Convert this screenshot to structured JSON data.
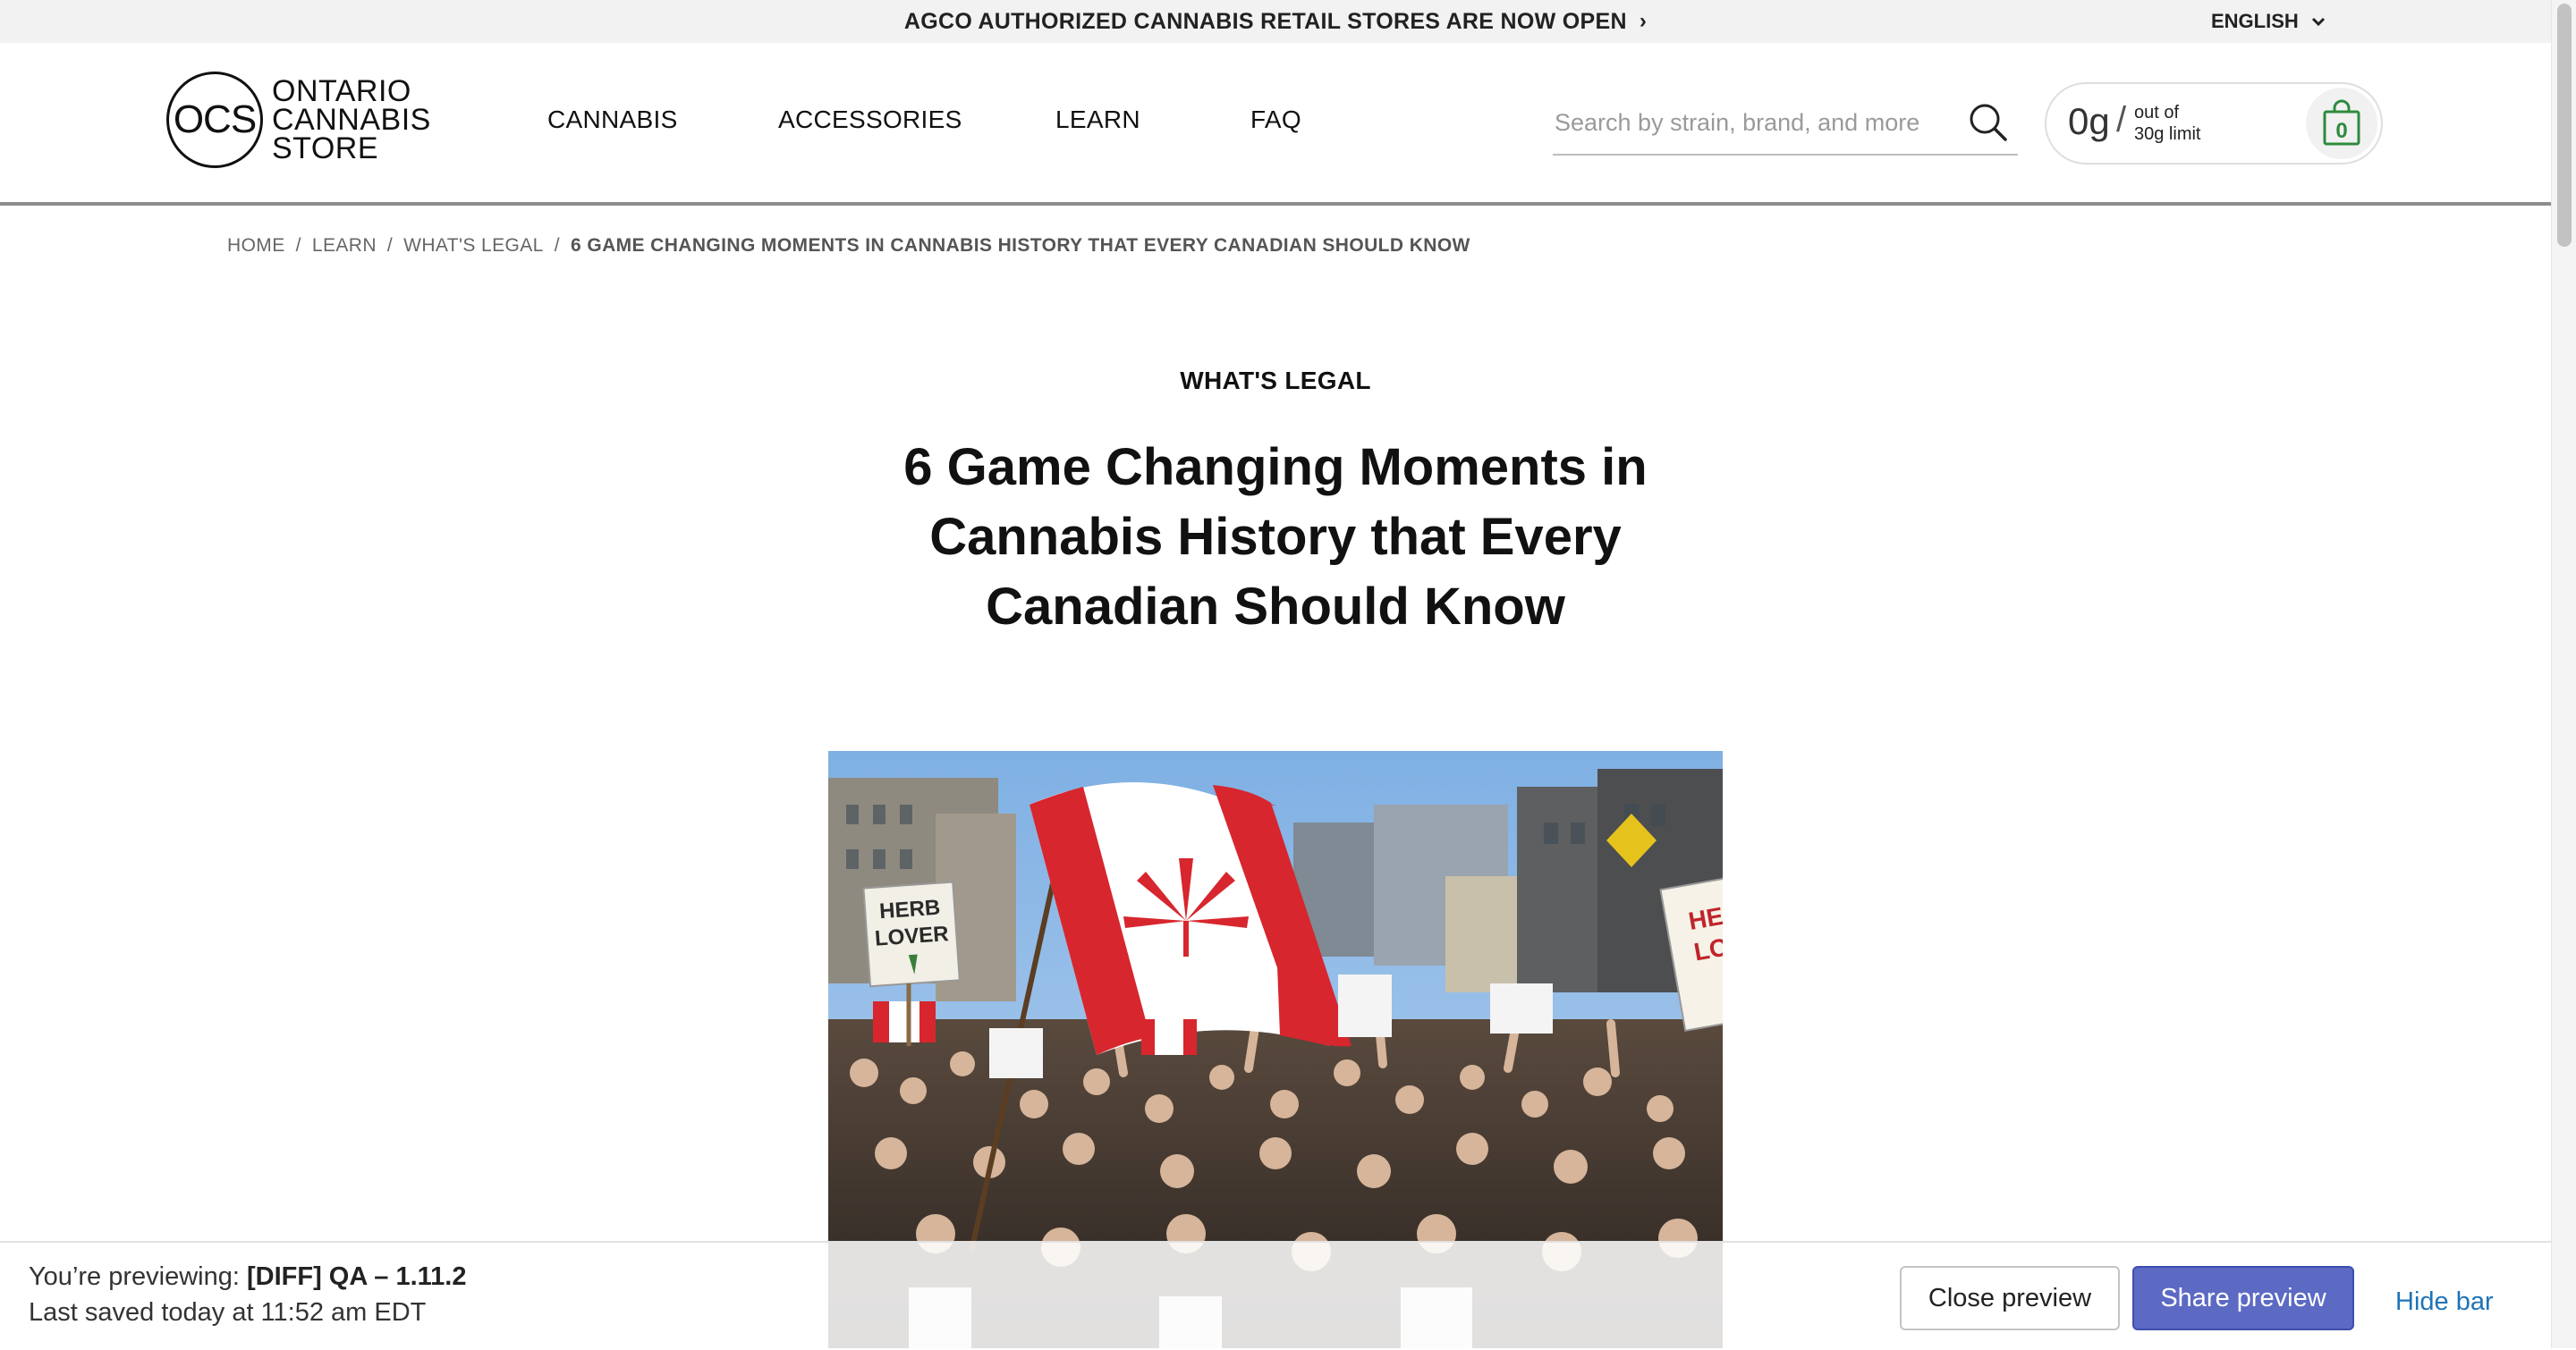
{
  "announcement": {
    "text": "AGCO AUTHORIZED CANNABIS RETAIL STORES ARE NOW OPEN",
    "chevron": "›"
  },
  "language": {
    "label": "ENGLISH"
  },
  "logo": {
    "monogram": "OCS",
    "line1": "ONTARIO",
    "line2": "CANNABIS",
    "line3": "STORE"
  },
  "nav": {
    "items": [
      {
        "label": "CANNABIS"
      },
      {
        "label": "ACCESSORIES"
      },
      {
        "label": "LEARN"
      },
      {
        "label": "FAQ"
      }
    ]
  },
  "search": {
    "placeholder": "Search by strain, brand, and more",
    "icon": "search-icon"
  },
  "limit": {
    "amount": "0g",
    "slash": "/",
    "line1": "out of",
    "line2": "30g limit",
    "cart_count": "0",
    "icon": "shopping-bag-icon"
  },
  "breadcrumb": {
    "items": [
      "HOME",
      "LEARN",
      "WHAT'S LEGAL"
    ],
    "current": "6 GAME CHANGING MOMENTS IN CANNABIS HISTORY THAT EVERY CANADIAN SHOULD KNOW",
    "separator": "/"
  },
  "article": {
    "category": "WHAT'S LEGAL",
    "title": "6 Game Changing Moments in Cannabis History that Every Canadian Should Know",
    "hero_signs": {
      "left": "HERB LOVER",
      "right": "HERB LOVER"
    }
  },
  "preview": {
    "label": "You’re previewing:",
    "theme": "[DIFF] QA – 1.11.2",
    "saved": "Last saved today at 11:52 am EDT",
    "close_label": "Close preview",
    "share_label": "Share preview",
    "hide_label": "Hide bar"
  },
  "colors": {
    "accent": "#5c6ac4",
    "link": "#1f73b7",
    "bag": "#2e8b3d"
  }
}
